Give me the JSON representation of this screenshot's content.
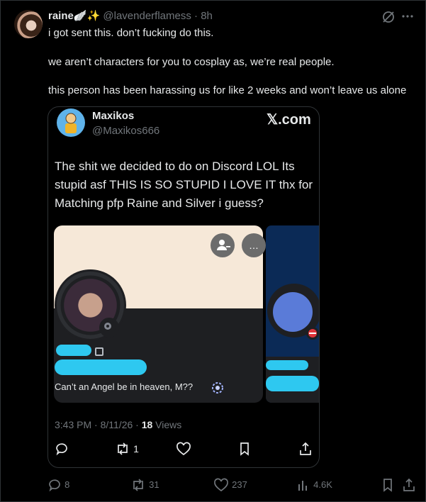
{
  "post": {
    "author_name": "raine",
    "author_emojis": "🪽✨",
    "author_handle": "@lavenderflamess",
    "separator": " · ",
    "time": "8h",
    "lines": [
      "i got sent this. don’t fucking do this.",
      "we aren’t characters for you to cosplay as, we’re real people.",
      "this person has been harassing us for like 2 weeks and won’t leave us alone"
    ]
  },
  "quoted": {
    "name": "Maxikos",
    "handle": "@Maxikos666",
    "site_logo": "𝕏.com",
    "text_lines": [
      "The shit we decided to do on Discord LOL Its",
      "stupid asf THIS IS SO STUPID I LOVE IT thx for",
      "Matching pfp Raine and Silver i guess?"
    ],
    "media": {
      "bio": "Can’t an Angel be in heaven, M??",
      "more_icon": "…"
    },
    "time": "3:43 PM",
    "date": "8/11/26",
    "dot": " · ",
    "views_count": "18",
    "views_label": " Views",
    "actions": {
      "reposts": "1"
    }
  },
  "actions": {
    "replies": "8",
    "reposts": "31",
    "likes": "237",
    "views": "4.6K"
  },
  "icons": [
    "grok-icon",
    "more-icon",
    "reply-icon",
    "repost-icon",
    "like-icon",
    "bookmark-icon",
    "share-icon",
    "views-icon"
  ],
  "colors": {
    "background": "#000000",
    "text": "#e7e9ea",
    "muted": "#71767b",
    "border": "#2f3336"
  }
}
